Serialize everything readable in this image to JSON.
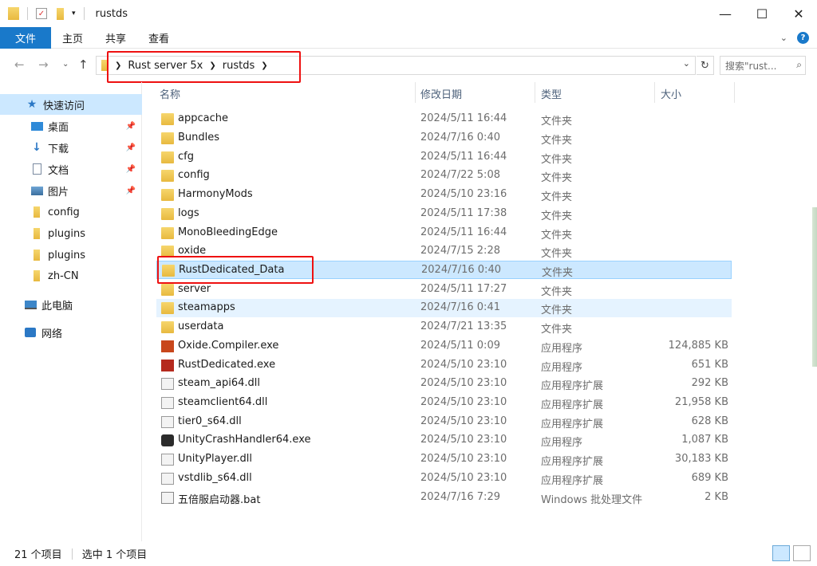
{
  "window": {
    "title": "rustds",
    "controls": {
      "minimize": "—",
      "maximize": "☐",
      "close": "✕"
    }
  },
  "ribbon": {
    "tabs": [
      "文件",
      "主页",
      "共享",
      "查看"
    ]
  },
  "address": {
    "crumbs": [
      "Rust server 5x",
      "rustds"
    ],
    "search_placeholder": "搜索\"rust..."
  },
  "sidebar": {
    "items": [
      {
        "label": "快速访问",
        "icon": "star-icon",
        "pinned": false
      },
      {
        "label": "桌面",
        "icon": "desktop-icon",
        "pinned": true
      },
      {
        "label": "下载",
        "icon": "download-icon",
        "pinned": true
      },
      {
        "label": "文档",
        "icon": "document-icon",
        "pinned": true
      },
      {
        "label": "图片",
        "icon": "picture-icon",
        "pinned": true
      },
      {
        "label": "config",
        "icon": "folder-icon",
        "pinned": false
      },
      {
        "label": "plugins",
        "icon": "folder-icon",
        "pinned": false
      },
      {
        "label": "plugins",
        "icon": "folder-icon",
        "pinned": false
      },
      {
        "label": "zh-CN",
        "icon": "folder-icon",
        "pinned": false
      },
      {
        "label": "此电脑",
        "icon": "computer-icon",
        "pinned": false
      },
      {
        "label": "网络",
        "icon": "network-icon",
        "pinned": false
      }
    ]
  },
  "columns": {
    "name": "名称",
    "date": "修改日期",
    "type": "类型",
    "size": "大小"
  },
  "files": [
    {
      "name": "appcache",
      "date": "2024/5/11 16:44",
      "type": "文件夹",
      "size": "",
      "icon": "folder-icon"
    },
    {
      "name": "Bundles",
      "date": "2024/7/16 0:40",
      "type": "文件夹",
      "size": "",
      "icon": "folder-icon"
    },
    {
      "name": "cfg",
      "date": "2024/5/11 16:44",
      "type": "文件夹",
      "size": "",
      "icon": "folder-icon"
    },
    {
      "name": "config",
      "date": "2024/7/22 5:08",
      "type": "文件夹",
      "size": "",
      "icon": "folder-icon"
    },
    {
      "name": "HarmonyMods",
      "date": "2024/5/10 23:16",
      "type": "文件夹",
      "size": "",
      "icon": "folder-icon"
    },
    {
      "name": "logs",
      "date": "2024/5/11 17:38",
      "type": "文件夹",
      "size": "",
      "icon": "folder-icon"
    },
    {
      "name": "MonoBleedingEdge",
      "date": "2024/5/11 16:44",
      "type": "文件夹",
      "size": "",
      "icon": "folder-icon"
    },
    {
      "name": "oxide",
      "date": "2024/7/15 2:28",
      "type": "文件夹",
      "size": "",
      "icon": "folder-icon"
    },
    {
      "name": "RustDedicated_Data",
      "date": "2024/7/16 0:40",
      "type": "文件夹",
      "size": "",
      "icon": "folder-icon"
    },
    {
      "name": "server",
      "date": "2024/5/11 17:27",
      "type": "文件夹",
      "size": "",
      "icon": "folder-icon"
    },
    {
      "name": "steamapps",
      "date": "2024/7/16 0:41",
      "type": "文件夹",
      "size": "",
      "icon": "folder-icon"
    },
    {
      "name": "userdata",
      "date": "2024/7/21 13:35",
      "type": "文件夹",
      "size": "",
      "icon": "folder-icon"
    },
    {
      "name": "Oxide.Compiler.exe",
      "date": "2024/5/11 0:09",
      "type": "应用程序",
      "size": "124,885 KB",
      "icon": "rust-exe-icon"
    },
    {
      "name": "RustDedicated.exe",
      "date": "2024/5/10 23:10",
      "type": "应用程序",
      "size": "651 KB",
      "icon": "rust-exe-icon"
    },
    {
      "name": "steam_api64.dll",
      "date": "2024/5/10 23:10",
      "type": "应用程序扩展",
      "size": "292 KB",
      "icon": "dll-icon"
    },
    {
      "name": "steamclient64.dll",
      "date": "2024/5/10 23:10",
      "type": "应用程序扩展",
      "size": "21,958 KB",
      "icon": "dll-icon"
    },
    {
      "name": "tier0_s64.dll",
      "date": "2024/5/10 23:10",
      "type": "应用程序扩展",
      "size": "628 KB",
      "icon": "dll-icon"
    },
    {
      "name": "UnityCrashHandler64.exe",
      "date": "2024/5/10 23:10",
      "type": "应用程序",
      "size": "1,087 KB",
      "icon": "unity-icon"
    },
    {
      "name": "UnityPlayer.dll",
      "date": "2024/5/10 23:10",
      "type": "应用程序扩展",
      "size": "30,183 KB",
      "icon": "dll-icon"
    },
    {
      "name": "vstdlib_s64.dll",
      "date": "2024/5/10 23:10",
      "type": "应用程序扩展",
      "size": "689 KB",
      "icon": "dll-icon"
    },
    {
      "name": "五倍服启动器.bat",
      "date": "2024/7/16 7:29",
      "type": "Windows 批处理文件",
      "size": "2 KB",
      "icon": "batch-file-icon"
    }
  ],
  "status": {
    "count": "21 个项目",
    "selected": "选中 1 个项目"
  },
  "colors": {
    "accent": "#1979ca",
    "selection": "#cce8ff",
    "highlight_box": "#ee1111"
  }
}
